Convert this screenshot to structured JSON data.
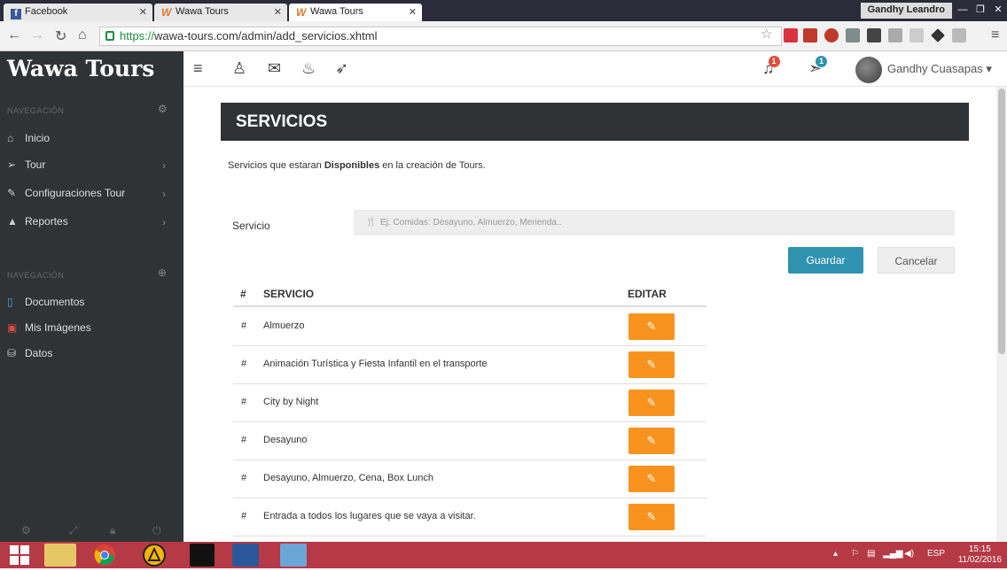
{
  "browser": {
    "tabs": [
      {
        "label": "Facebook"
      },
      {
        "label": "Wawa Tours"
      },
      {
        "label": "Wawa Tours"
      }
    ],
    "window_user": "Gandhy Leandro",
    "url_scheme": "https://",
    "url_rest": "wawa-tours.com/admin/add_servicios.xhtml"
  },
  "header": {
    "brand": "Wawa Tours",
    "notifications_count": "1",
    "messages_count": "1",
    "user_name": "Gandhy Cuasapas"
  },
  "sidebar": {
    "section1_title": "NAVEGACIÓN",
    "items": [
      {
        "label": "Inicio"
      },
      {
        "label": "Tour"
      },
      {
        "label": "Configuraciones Tour"
      },
      {
        "label": "Reportes"
      }
    ],
    "section2_title": "NAVEGACIÓN",
    "items2": [
      {
        "label": "Documentos"
      },
      {
        "label": "Mis Imágenes"
      },
      {
        "label": "Datos"
      }
    ]
  },
  "main": {
    "panel_title": "SERVICIOS",
    "desc_pre": "Servicios que estaran ",
    "desc_bold": "Disponibles",
    "desc_post": " en la creación de Tours.",
    "field_label": "Servicio",
    "field_placeholder": "Ej: Comidas: Desayuno, Almuerzo, Merienda..",
    "save_label": "Guardar",
    "cancel_label": "Cancelar",
    "table": {
      "col_num": "#",
      "col_service": "SERVICIO",
      "col_edit": "EDITAR",
      "rows": [
        {
          "num": "#",
          "name": "Almuerzo"
        },
        {
          "num": "#",
          "name": "Animación Turística y Fiesta Infantil en el transporte"
        },
        {
          "num": "#",
          "name": "City by Night"
        },
        {
          "num": "#",
          "name": "Desayuno"
        },
        {
          "num": "#",
          "name": "Desayuno, Almuerzo, Cena, Box Lunch"
        },
        {
          "num": "#",
          "name": "Entrada a todos los lugares que se vaya a visitar."
        }
      ]
    }
  },
  "taskbar": {
    "language": "ESP",
    "time": "15:15",
    "date": "11/02/2016"
  },
  "colors": {
    "dark": "#303336",
    "accent_blue": "#2f93b0",
    "accent_orange": "#f7931e",
    "taskbar": "#b53a45"
  }
}
